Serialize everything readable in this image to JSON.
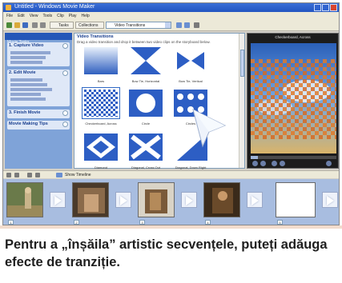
{
  "window": {
    "title": "Untitled - Windows Movie Maker",
    "menu": [
      "File",
      "Edit",
      "View",
      "Tools",
      "Clip",
      "Play",
      "Help"
    ]
  },
  "toolbar": {
    "tasks_label": "Tasks",
    "collections_label": "Collections",
    "collection_value": "Video Transitions"
  },
  "tasks_pane": {
    "header": "Movie Tasks",
    "groups": [
      {
        "title": "1. Capture Video"
      },
      {
        "title": "2. Edit Movie"
      },
      {
        "title": "3. Finish Movie"
      },
      {
        "title": "Movie Making Tips"
      }
    ]
  },
  "content": {
    "title": "Video Transitions",
    "subtitle": "Drag a video transition and drop it between two video clips on the storyboard below.",
    "tiles": [
      {
        "label": "Bars",
        "icon": "bars-transition-icon"
      },
      {
        "label": "Bow Tie, Horizontal",
        "icon": "bowtie-horizontal-icon"
      },
      {
        "label": "Bow Tie, Vertical",
        "icon": "bowtie-vertical-icon"
      },
      {
        "label": "Checkerboard, Across",
        "icon": "checkerboard-icon"
      },
      {
        "label": "Circle",
        "icon": "circle-transition-icon"
      },
      {
        "label": "Circles",
        "icon": "circles-transition-icon"
      },
      {
        "label": "Diamond",
        "icon": "diamond-transition-icon"
      },
      {
        "label": "Diagonal, Cross Out",
        "icon": "cross-out-icon"
      },
      {
        "label": "Diagonal, Down Right",
        "icon": "diagonal-down-right-icon"
      }
    ]
  },
  "preview": {
    "title": "Checkerboard, Across",
    "progress_fraction": 0.08
  },
  "storyboard": {
    "label": "Show Timeline",
    "clips": [
      "1",
      "2",
      "3",
      "4",
      "5"
    ]
  },
  "caption": {
    "text": "Pentru a „înșăila” artistic secvențele, puteți adăuga efecte de tranziție."
  }
}
